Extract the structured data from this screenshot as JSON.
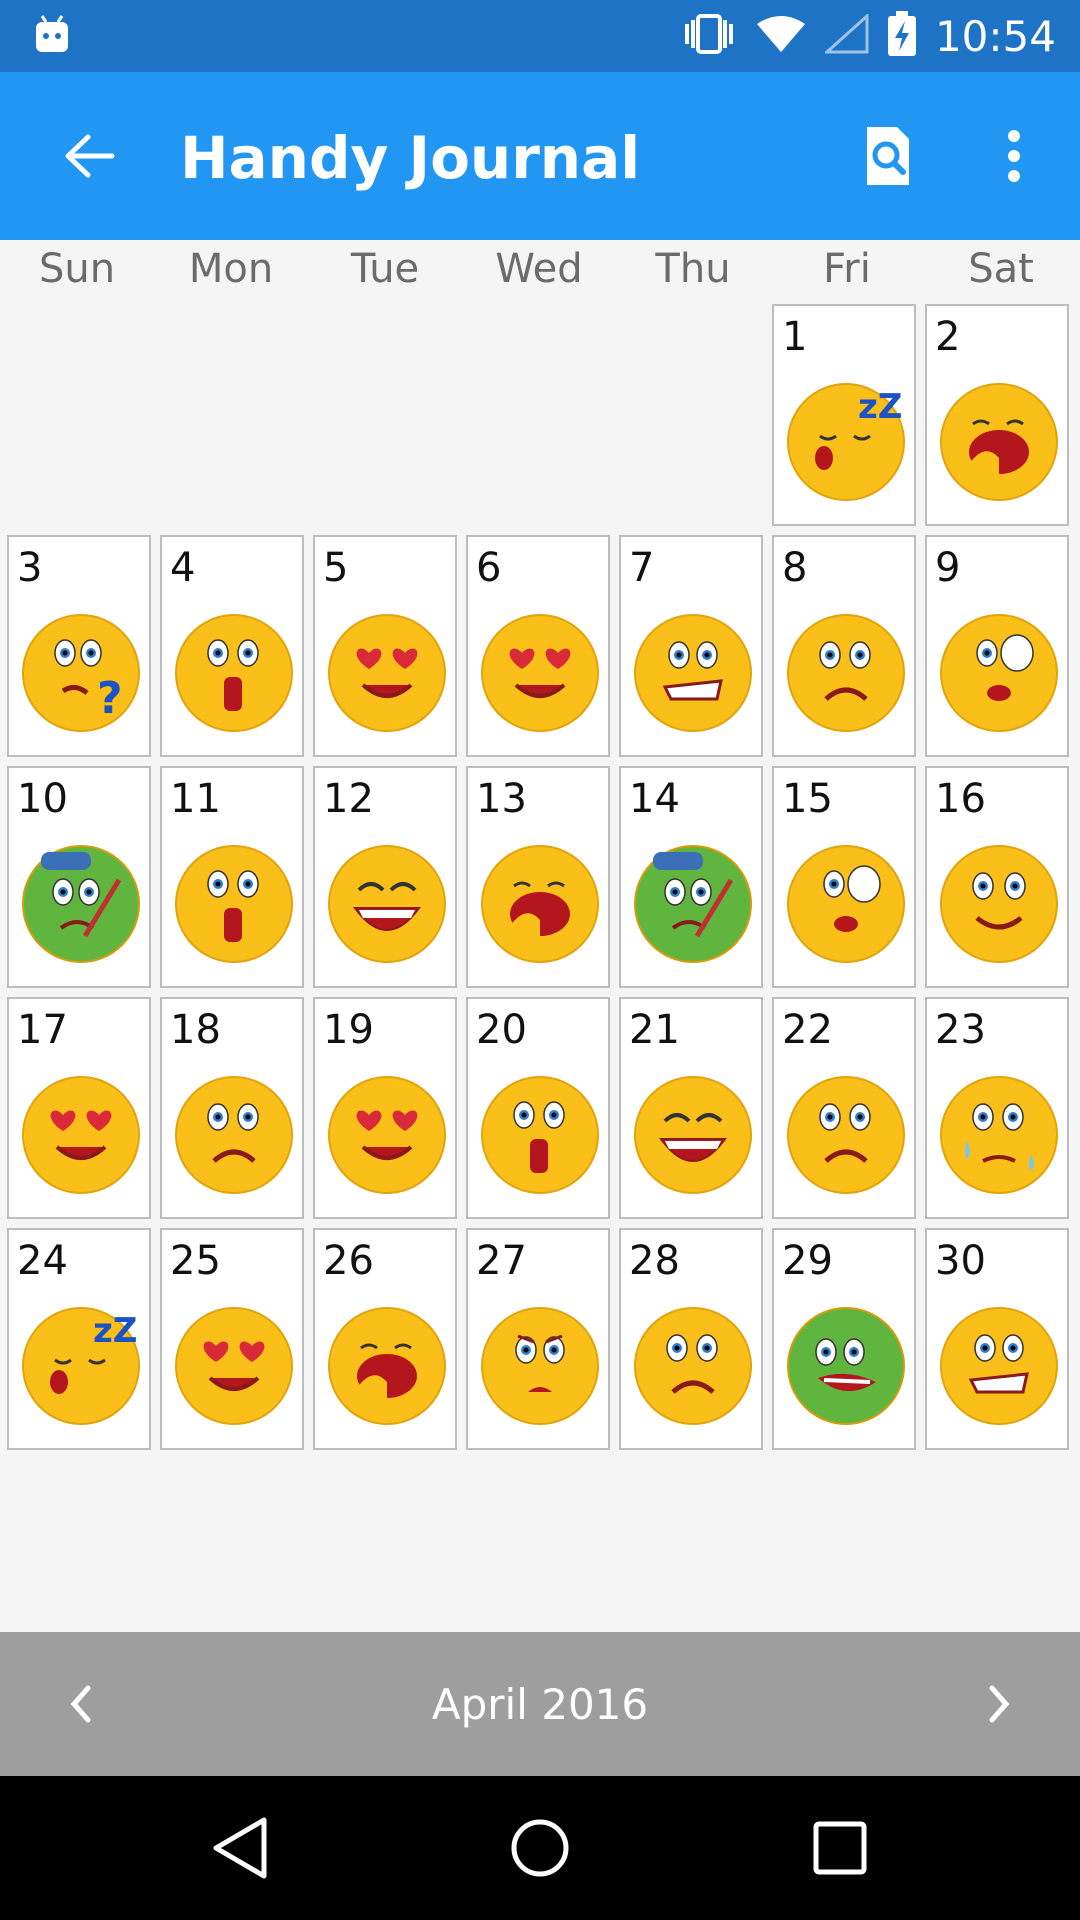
{
  "status_bar": {
    "time": "10:54"
  },
  "app_bar": {
    "title": "Handy Journal"
  },
  "calendar": {
    "weekdays": [
      "Sun",
      "Mon",
      "Tue",
      "Wed",
      "Thu",
      "Fri",
      "Sat"
    ],
    "month_label": "April 2016",
    "days": [
      {
        "day": "1",
        "mood": "sleepy"
      },
      {
        "day": "2",
        "mood": "yawn"
      },
      {
        "day": "3",
        "mood": "confused"
      },
      {
        "day": "4",
        "mood": "shocked"
      },
      {
        "day": "5",
        "mood": "in-love"
      },
      {
        "day": "6",
        "mood": "in-love"
      },
      {
        "day": "7",
        "mood": "awkward"
      },
      {
        "day": "8",
        "mood": "sad"
      },
      {
        "day": "9",
        "mood": "surprised"
      },
      {
        "day": "10",
        "mood": "sick"
      },
      {
        "day": "11",
        "mood": "shocked"
      },
      {
        "day": "12",
        "mood": "laughing"
      },
      {
        "day": "13",
        "mood": "yawn"
      },
      {
        "day": "14",
        "mood": "sick"
      },
      {
        "day": "15",
        "mood": "surprised"
      },
      {
        "day": "16",
        "mood": "pleased"
      },
      {
        "day": "17",
        "mood": "in-love"
      },
      {
        "day": "18",
        "mood": "sad"
      },
      {
        "day": "19",
        "mood": "in-love"
      },
      {
        "day": "20",
        "mood": "shocked"
      },
      {
        "day": "21",
        "mood": "laughing"
      },
      {
        "day": "22",
        "mood": "sad"
      },
      {
        "day": "23",
        "mood": "crying"
      },
      {
        "day": "24",
        "mood": "sleepy"
      },
      {
        "day": "25",
        "mood": "in-love"
      },
      {
        "day": "26",
        "mood": "yawn"
      },
      {
        "day": "27",
        "mood": "worried"
      },
      {
        "day": "28",
        "mood": "sad"
      },
      {
        "day": "29",
        "mood": "nauseous"
      },
      {
        "day": "30",
        "mood": "awkward"
      }
    ]
  },
  "colors": {
    "status_bar": "#1f73c7",
    "app_bar": "#2196f3",
    "month_bar": "#9e9e9e",
    "emoji_yellow": "#fbbf1a",
    "emoji_green": "#5fb53e"
  }
}
